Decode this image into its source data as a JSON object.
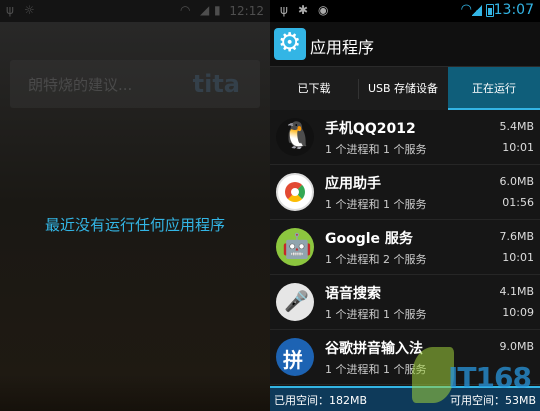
{
  "left": {
    "status_time": "12:12",
    "search_placeholder": "朗特烧的建议...",
    "search_logo": "tita",
    "empty_message": "最近没有运行任何应用程序"
  },
  "status": {
    "time": "13:07"
  },
  "actionbar": {
    "title": "应用程序"
  },
  "tabs": [
    {
      "label": "已下载",
      "active": false
    },
    {
      "label": "USB 存储设备",
      "active": false
    },
    {
      "label": "正在运行",
      "active": true
    }
  ],
  "apps": [
    {
      "name": "手机QQ2012",
      "sub": "1 个进程和 1 个服务",
      "memory": "5.4MB",
      "time": "10:01",
      "icon": "qq-penguin-icon"
    },
    {
      "name": "应用助手",
      "sub": "1 个进程和 1 个服务",
      "memory": "6.0MB",
      "time": "01:56",
      "icon": "app-helper-icon"
    },
    {
      "name": "Google 服务",
      "sub": "1 个进程和 2 个服务",
      "memory": "7.6MB",
      "time": "10:01",
      "icon": "android-robot-icon"
    },
    {
      "name": "语音搜索",
      "sub": "1 个进程和 1 个服务",
      "memory": "4.1MB",
      "time": "10:09",
      "icon": "microphone-icon"
    },
    {
      "name": "谷歌拼音输入法",
      "sub": "1 个进程和 1 个服务",
      "memory": "9.0MB",
      "time": "",
      "icon": "pinyin-ime-icon"
    }
  ],
  "footer": {
    "used": "已用空间：182MB",
    "available": "可用空间：53MB"
  },
  "watermark": "IT168"
}
